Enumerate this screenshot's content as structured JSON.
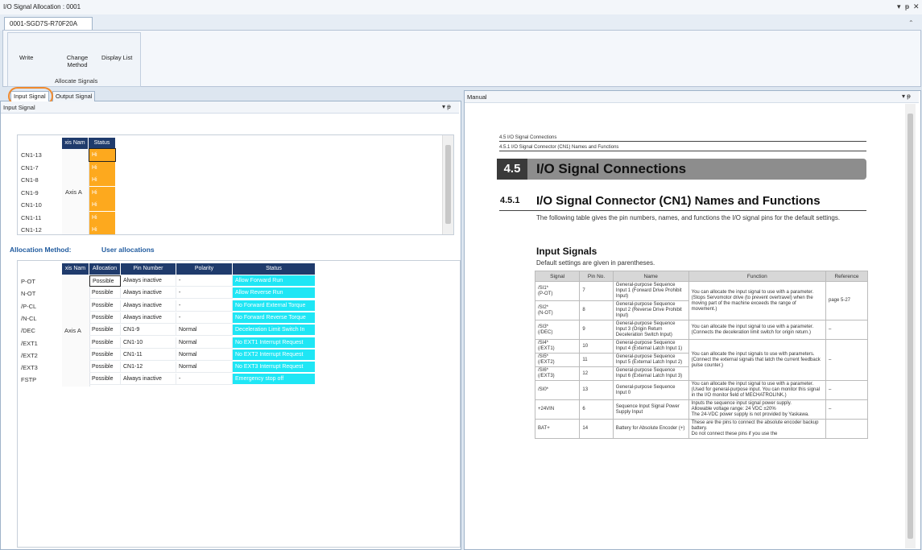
{
  "window": {
    "title": "I/O Signal Allocation : 0001",
    "controls": [
      "▾",
      "ᵽ",
      "✕"
    ]
  },
  "ribbon": {
    "tab": "0001-SGD7S-R70F20A",
    "collapse": "⌃",
    "buttons": [
      "Write",
      "Change\nMethod",
      "Display List"
    ],
    "group": "Allocate Signals"
  },
  "tabs": {
    "input": "Input Signal",
    "output": "Output Signal"
  },
  "left_header": "Input Signal",
  "grid1": {
    "headers": [
      "xis Nam",
      "Status"
    ],
    "rows": [
      "CN1-13",
      "CN1-7",
      "CN1-8",
      "CN1-9",
      "CN1-10",
      "CN1-11",
      "CN1-12"
    ],
    "axis": "Axis A",
    "status": "Hi"
  },
  "allocation": {
    "label": "Allocation Method:",
    "value": "User allocations"
  },
  "grid2": {
    "headers": [
      "xis Nam",
      "Allocation",
      "Pin Number",
      "Polarity",
      "Status"
    ],
    "axis": "Axis A",
    "rows": [
      {
        "name": "P-OT",
        "alloc": "Possible",
        "pin": "Always inactive",
        "pol": "-",
        "status": "Allow Forward Run"
      },
      {
        "name": "N-OT",
        "alloc": "Possible",
        "pin": "Always inactive",
        "pol": "-",
        "status": "Allow Reverse Run"
      },
      {
        "name": "/P-CL",
        "alloc": "Possible",
        "pin": "Always inactive",
        "pol": "-",
        "status": "No Forward External Torque"
      },
      {
        "name": "/N-CL",
        "alloc": "Possible",
        "pin": "Always inactive",
        "pol": "-",
        "status": "No Forward Reverse Torque"
      },
      {
        "name": "/DEC",
        "alloc": "Possible",
        "pin": "CN1-9",
        "pol": "Normal",
        "status": "Deceleration Limit Switch In"
      },
      {
        "name": "/EXT1",
        "alloc": "Possible",
        "pin": "CN1-10",
        "pol": "Normal",
        "status": "No EXT1 Interrupt Request"
      },
      {
        "name": "/EXT2",
        "alloc": "Possible",
        "pin": "CN1-11",
        "pol": "Normal",
        "status": "No EXT2 Interrupt Request"
      },
      {
        "name": "/EXT3",
        "alloc": "Possible",
        "pin": "CN1-12",
        "pol": "Normal",
        "status": "No EXT3 Interrupt Request"
      },
      {
        "name": "FSTP",
        "alloc": "Possible",
        "pin": "Always inactive",
        "pol": "-",
        "status": "Emergency stop off"
      }
    ]
  },
  "manual": {
    "header": "Manual",
    "crumb1": "4.5  I/O Signal Connections",
    "crumb2": "4.5.1  I/O Signal Connector (CN1) Names and Functions",
    "sec_num": "4.5",
    "sec_title": "I/O Signal Connections",
    "sub_num": "4.5.1",
    "sub_title": "I/O Signal Connector (CN1) Names and Functions",
    "intro": "The following table gives the pin numbers, names, and functions the I/O signal pins for the default settings.",
    "input_title": "Input Signals",
    "input_note": "Default settings are given in parentheses.",
    "table_headers": [
      "Signal",
      "Pin No.",
      "Name",
      "Function",
      "Reference"
    ],
    "table_rows": [
      {
        "signal": "/SI1*\n(P-OT)",
        "pin": "7",
        "name": "General-purpose Sequence Input 1 (Forward Drive Prohibit Input)",
        "function": "You can allocate the input signal to use with a parameter.\n(Stops Servomotor drive (to prevent overtravel) when the moving part of the machine exceeds the range of movement.)",
        "ref": "page 5-27"
      },
      {
        "signal": "/SI2*\n(N-OT)",
        "pin": "8",
        "name": "General-purpose Sequence Input 2 (Reverse Drive Prohibit Input)",
        "function": "",
        "ref": ""
      },
      {
        "signal": "/SI3*\n(/DEC)",
        "pin": "9",
        "name": "General-purpose Sequence Input 3 (Origin Return Deceleration Switch Input)",
        "function": "You can allocate the input signal to use with a parameter.\n(Connects the deceleration limit switch for origin return.)",
        "ref": "–"
      },
      {
        "signal": "/SI4*\n(/EXT1)",
        "pin": "10",
        "name": "General-purpose Sequence Input 4 (External Latch Input 1)",
        "function": "You can allocate the input signals to use with parameters.\n(Connect the external signals that latch the current feedback pulse counter.)",
        "ref": "–"
      },
      {
        "signal": "/SI5*\n(/EXT2)",
        "pin": "11",
        "name": "General-purpose Sequence Input 5 (External Latch Input 2)",
        "function": "",
        "ref": ""
      },
      {
        "signal": "/SI6*\n(/EXT3)",
        "pin": "12",
        "name": "General-purpose Sequence Input 6 (External Latch Input 3)",
        "function": "",
        "ref": ""
      },
      {
        "signal": "/SI0*",
        "pin": "13",
        "name": "General-purpose Sequence Input 0",
        "function": "You can allocate the input signal to use with a parameter.\n(Used for general-purpose input. You can monitor this signal in the I/O monitor field of MECHATROLINK.)",
        "ref": "–"
      },
      {
        "signal": "+24VIN",
        "pin": "6",
        "name": "Sequence Input Signal Power Supply Input",
        "function": "Inputs the sequence input signal power supply.\nAllowable voltage range: 24 VDC ±20%\nThe 24-VDC power supply is not provided by Yaskawa.",
        "ref": "–"
      },
      {
        "signal": "BAT+",
        "pin": "14",
        "name": "Battery for Absolute Encoder (+)",
        "function": "These are the pins to connect the absolute encoder backup battery.\nDo not connect these pins if you use the",
        "ref": ""
      }
    ]
  },
  "colors": {
    "header_navy": "#1f3b6c",
    "status_hi": "#fda91e",
    "status_cyan": "#1fe6f5",
    "accent_blue": "#1f5a9e",
    "highlight_circle": "#f0892c"
  }
}
